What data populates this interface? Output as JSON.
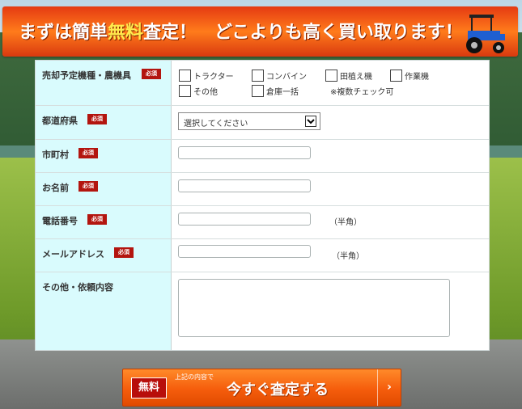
{
  "banner": {
    "text_before": "まずは簡単",
    "text_accent": "無料",
    "text_after": "査定！　どこよりも高く買い取ります！"
  },
  "form": {
    "required_label": "必須",
    "fields": {
      "equipment": {
        "label": "売却予定機種・農機具",
        "options": [
          "トラクター",
          "コンバイン",
          "田植え機",
          "作業機",
          "その他",
          "倉庫一括"
        ],
        "note": "※複数チェック可"
      },
      "prefecture": {
        "label": "都道府県",
        "selected": "選択してください"
      },
      "city": {
        "label": "市町村",
        "value": ""
      },
      "name": {
        "label": "お名前",
        "value": ""
      },
      "phone": {
        "label": "電話番号",
        "value": "",
        "note": "（半角）"
      },
      "email": {
        "label": "メールアドレス",
        "value": "",
        "note": "（半角）"
      },
      "other": {
        "label": "その他・依頼内容",
        "value": ""
      }
    }
  },
  "submit": {
    "badge": "無料",
    "small_text": "上記の内容で",
    "main_text": "今すぐ査定する",
    "arrow": "›"
  },
  "colors": {
    "banner": "#f0531a",
    "label_bg": "#d9fbfd",
    "required_bg": "#b3150f",
    "submit": "#f55d0c"
  },
  "icons": {
    "banner_vehicle": "tractor-icon",
    "select_arrow": "chevron-down-icon",
    "submit_arrow": "chevron-right-icon"
  }
}
